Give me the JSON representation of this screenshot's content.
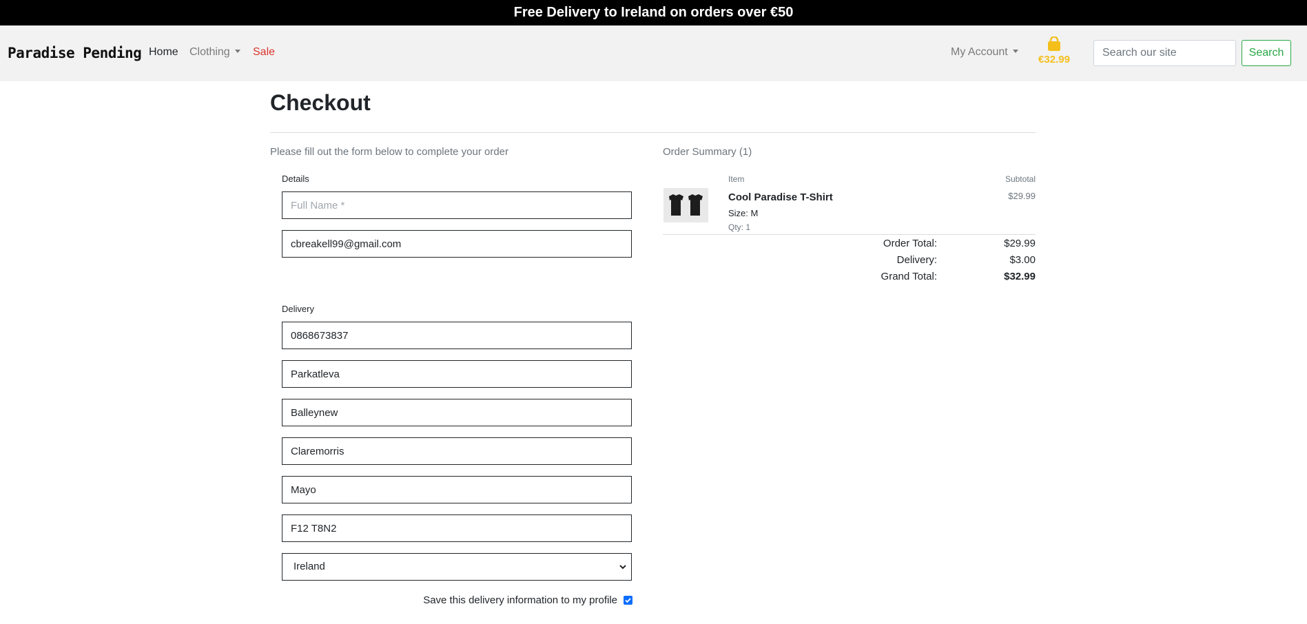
{
  "banner": {
    "text": "Free Delivery to Ireland on orders over €50"
  },
  "nav": {
    "brand": "Paradise Pending",
    "home": "Home",
    "clothing": "Clothing",
    "sale": "Sale",
    "account": "My Account",
    "cart_total": "€32.99",
    "search_placeholder": "Search our site",
    "search_button": "Search",
    "colors": {
      "sale": "#d9342b",
      "cart": "#f4bf1b",
      "search": "#28a745"
    }
  },
  "checkout": {
    "title": "Checkout",
    "intro": "Please fill out the form below to complete your order",
    "details_label": "Details",
    "full_name_placeholder": "Full Name *",
    "email": "cbreakell99@gmail.com",
    "delivery_label": "Delivery",
    "phone": "0868673837",
    "street1": "Parkatleva",
    "street2": "Balleynew",
    "town": "Claremorris",
    "county": "Mayo",
    "postcode": "F12 T8N2",
    "country": "Ireland",
    "save_label": "Save this delivery information to my profile",
    "save_checked": true
  },
  "summary": {
    "title": "Order Summary (1)",
    "item_header": "Item",
    "subtotal_header": "Subtotal",
    "item": {
      "name": "Cool Paradise T-Shirt",
      "size": "Size: M",
      "qty": "Qty: 1",
      "price": "$29.99",
      "image_icon": "tshirt-icon"
    },
    "order_total_label": "Order Total:",
    "order_total": "$29.99",
    "delivery_label": "Delivery:",
    "delivery": "$3.00",
    "grand_total_label": "Grand Total:",
    "grand_total": "$32.99"
  }
}
